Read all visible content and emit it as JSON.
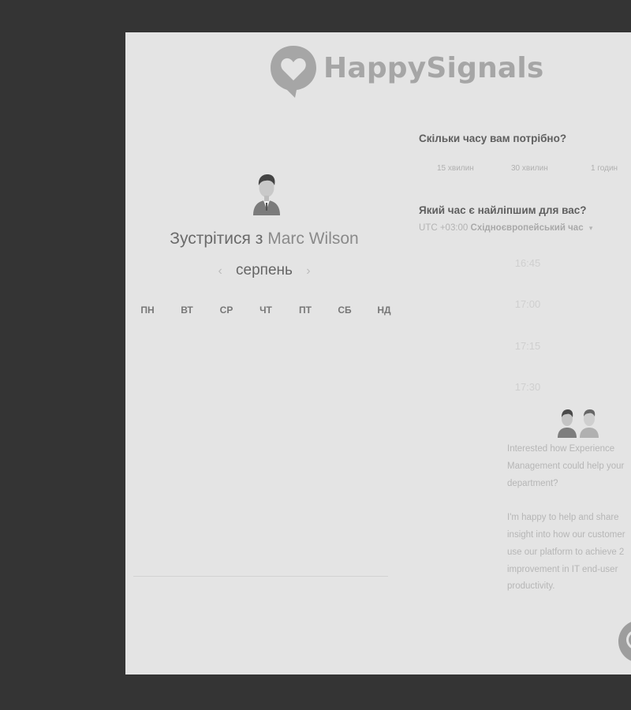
{
  "brand": {
    "logo_text": "HappySignals",
    "logo_color": "#a6a6a6"
  },
  "host": {
    "title_prefix": "Зустрітися з",
    "name": "Marc Wilson"
  },
  "calendar": {
    "month": "серпень",
    "prev_arrow": "‹",
    "next_arrow": "›",
    "weekdays": [
      "ПН",
      "ВТ",
      "СР",
      "ЧТ",
      "ПТ",
      "СБ",
      "НД"
    ]
  },
  "duration": {
    "question": "Скільки часу вам потрібно?",
    "options": [
      "15 хвилин",
      "30 хвилин",
      "1 годин"
    ]
  },
  "time": {
    "question": "Який час є найліпшим для вас?",
    "tz_offset": "UTC +03:00",
    "tz_name": "Східноєвропейський час",
    "tz_caret": "▾",
    "slots": [
      "16:45",
      "17:00",
      "17:15",
      "17:30"
    ]
  },
  "pitch": {
    "paragraph1": [
      "Interested how Experience",
      "Management could help your",
      "department?"
    ],
    "paragraph2": [
      "I'm happy to help and share",
      "insight into how our customer",
      "use our platform to achieve 2",
      "improvement in IT end-user",
      "productivity."
    ]
  },
  "colors": {
    "background": "#343434",
    "panel": "#e4e4e4"
  },
  "icons": {
    "chat": "chat-bubble-icon"
  }
}
